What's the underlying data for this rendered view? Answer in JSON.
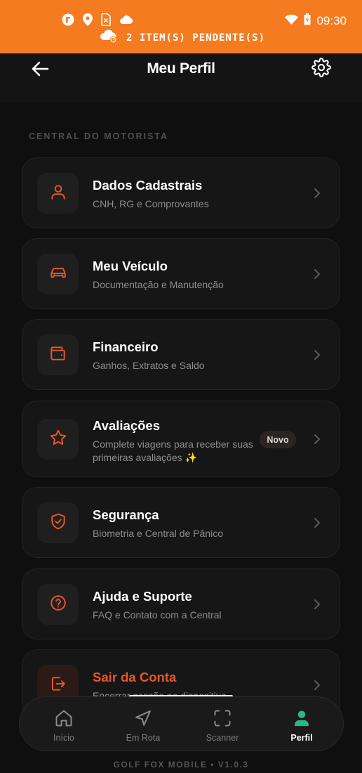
{
  "status_bar": {
    "time": "09:30",
    "pending_text": "2 ITEM(S) PENDENTE(S)",
    "icons": [
      "app-notification-icon",
      "location-icon",
      "sim-icon",
      "cloud-icon",
      "wifi-icon",
      "battery-icon"
    ]
  },
  "header": {
    "title": "Meu Perfil",
    "back_icon": "arrow-left-icon",
    "settings_icon": "gear-icon"
  },
  "section_label": "CENTRAL DO MOTORISTA",
  "menu": [
    {
      "icon": "user-icon",
      "title": "Dados Cadastrais",
      "subtitle": "CNH, RG e Comprovantes"
    },
    {
      "icon": "car-icon",
      "title": "Meu Veículo",
      "subtitle": "Documentação e Manutenção"
    },
    {
      "icon": "wallet-icon",
      "title": "Financeiro",
      "subtitle": "Ganhos, Extratos e Saldo"
    },
    {
      "icon": "star-icon",
      "title": "Avaliações",
      "subtitle": "Complete viagens para receber suas primeiras avaliações ✨",
      "badge": "Novo"
    },
    {
      "icon": "shield-check-icon",
      "title": "Segurança",
      "subtitle": "Biometria e Central de Pânico"
    },
    {
      "icon": "help-circle-icon",
      "title": "Ajuda e Suporte",
      "subtitle": "FAQ e Contato com a Central"
    },
    {
      "icon": "logout-icon",
      "title": "Sair da Conta",
      "subtitle": "Encerrar sessão no dispositivo"
    }
  ],
  "bottom_nav": [
    {
      "icon": "home-icon",
      "label": "Início"
    },
    {
      "icon": "navigation-icon",
      "label": "Em Rota"
    },
    {
      "icon": "scan-icon",
      "label": "Scanner"
    },
    {
      "icon": "profile-icon",
      "label": "Perfil",
      "active": true
    }
  ],
  "footer_version": "GOLF FOX MOBILE • V1.0.3",
  "colors": {
    "accent": "#f47b20",
    "icon_orange": "#e8562a",
    "background": "#0f0f0f",
    "card": "#161616",
    "active_nav": "#2bb58a"
  }
}
